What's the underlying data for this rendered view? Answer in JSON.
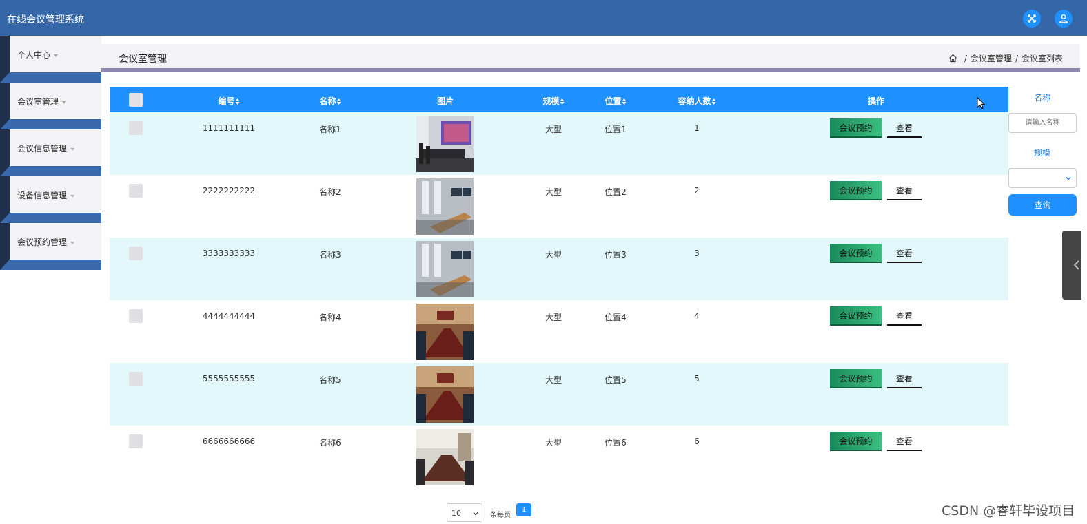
{
  "app": {
    "title": "在线会议管理系统"
  },
  "sidebar": {
    "items": [
      {
        "label": "个人中心"
      },
      {
        "label": "会议室管理"
      },
      {
        "label": "会议信息管理"
      },
      {
        "label": "设备信息管理"
      },
      {
        "label": "会议预约管理"
      }
    ]
  },
  "page": {
    "title": "会议室管理"
  },
  "breadcrumb": {
    "items": [
      "会议室管理",
      "会议室列表"
    ],
    "separator": "/"
  },
  "table": {
    "headers": {
      "id": "编号",
      "name": "名称",
      "image": "图片",
      "scale": "规模",
      "location": "位置",
      "capacity": "容纳人数",
      "actions": "操作"
    },
    "rows": [
      {
        "id": "1111111111",
        "name": "名称1",
        "scale": "大型",
        "location": "位置1",
        "capacity": "1",
        "book": "会议预约",
        "view": "查看"
      },
      {
        "id": "2222222222",
        "name": "名称2",
        "scale": "大型",
        "location": "位置2",
        "capacity": "2",
        "book": "会议预约",
        "view": "查看"
      },
      {
        "id": "3333333333",
        "name": "名称3",
        "scale": "大型",
        "location": "位置3",
        "capacity": "3",
        "book": "会议预约",
        "view": "查看"
      },
      {
        "id": "4444444444",
        "name": "名称4",
        "scale": "大型",
        "location": "位置4",
        "capacity": "4",
        "book": "会议预约",
        "view": "查看"
      },
      {
        "id": "5555555555",
        "name": "名称5",
        "scale": "大型",
        "location": "位置5",
        "capacity": "5",
        "book": "会议预约",
        "view": "查看"
      },
      {
        "id": "6666666666",
        "name": "名称6",
        "scale": "大型",
        "location": "位置6",
        "capacity": "6",
        "book": "会议预约",
        "view": "查看"
      }
    ]
  },
  "filter": {
    "name_label": "名称",
    "name_placeholder": "请输入名称",
    "scale_label": "规模",
    "scale_value": "",
    "search_label": "查询"
  },
  "pagination": {
    "page_size": "10",
    "per_page_label": "条每页",
    "current_page": "1"
  },
  "watermark": "CSDN @睿轩毕设项目",
  "colors": {
    "topbar": "#3566a8",
    "header": "#1e90ff",
    "row_alt": "#e2f8fa",
    "book_button": "#2aa06a"
  }
}
